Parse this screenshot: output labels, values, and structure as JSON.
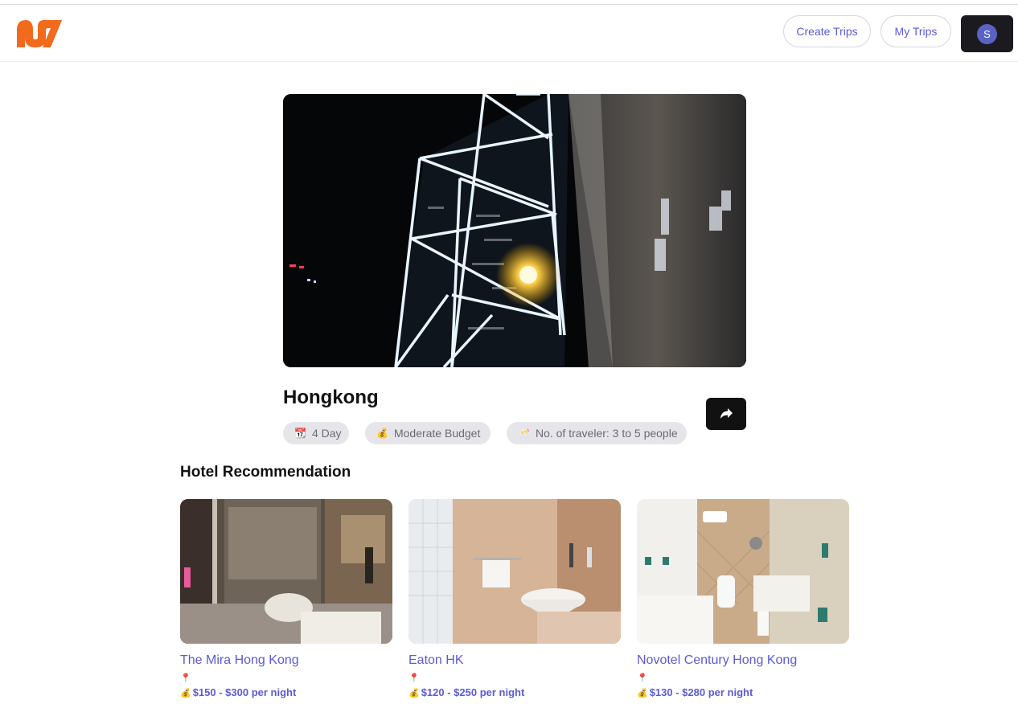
{
  "header": {
    "logo_icon": "tripgen-logo-icon",
    "create_trips_label": "Create Trips",
    "my_trips_label": "My Trips",
    "avatar_initial": "S"
  },
  "trip": {
    "destination": "Hongkong",
    "days": "4 Day",
    "budget": "Moderate Budget",
    "travelers": "No. of traveler: 3 to 5 people",
    "day_icon": "📆",
    "budget_icon": "💰",
    "travelers_icon": "🥂"
  },
  "hotels_section": {
    "title": "Hotel Recommendation",
    "items": [
      {
        "name": "The Mira Hong Kong",
        "location_icon": "📍",
        "price_icon": "💰",
        "price": "$150 - $300 per night"
      },
      {
        "name": "Eaton HK",
        "location_icon": "📍",
        "price_icon": "💰",
        "price": "$120 - $250 per night"
      },
      {
        "name": "Novotel Century Hong Kong",
        "location_icon": "📍",
        "price_icon": "💰",
        "price": "$130 - $280 per night"
      }
    ]
  },
  "colors": {
    "accent": "#5b5bd6",
    "logo": "#f26a1b",
    "dark_button": "#111111",
    "chip_bg": "#e6e6ea"
  }
}
